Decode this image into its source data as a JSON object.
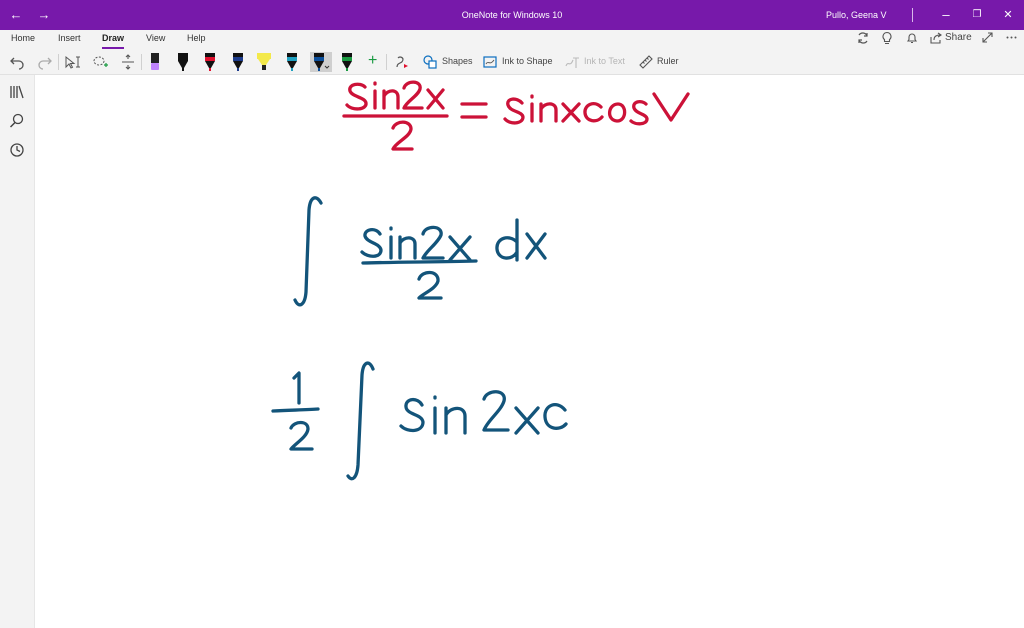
{
  "window": {
    "title": "OneNote for Windows 10",
    "user": "Pullo, Geena V",
    "back_label": "←",
    "forward_label": "→",
    "minimize_label": "–",
    "restore_label": "❐",
    "close_label": "✕"
  },
  "ribbon": {
    "tabs": [
      {
        "label": "Home"
      },
      {
        "label": "Insert"
      },
      {
        "label": "Draw"
      },
      {
        "label": "View"
      },
      {
        "label": "Help"
      }
    ],
    "active_tab": "Draw",
    "share_label": "Share"
  },
  "toolbar": {
    "shapes_label": "Shapes",
    "ink_to_shape_label": "Ink to Shape",
    "ink_to_text_label": "Ink to Text",
    "ruler_label": "Ruler",
    "add_pen_label": "+",
    "pens": [
      {
        "icon": "pencil-purple-icon",
        "color": "#c084fc"
      },
      {
        "icon": "pen-black-icon",
        "color": "#111111"
      },
      {
        "icon": "pen-red-icon",
        "color": "#e0102e"
      },
      {
        "icon": "pen-navy-icon",
        "color": "#1d3c8c"
      },
      {
        "icon": "highlighter-yellow-icon",
        "color": "#f3e94a"
      },
      {
        "icon": "pen-teal-icon",
        "color": "#1fa0c0"
      },
      {
        "icon": "pen-blue-icon",
        "color": "#0b4e9a"
      },
      {
        "icon": "pen-green-icon",
        "color": "#1a9a42"
      }
    ],
    "selected_pen": "pen-blue-icon"
  },
  "colors": {
    "accent": "#7719aa",
    "ink_red": "#cc1238",
    "ink_blue": "#13547a"
  },
  "sidebar": {
    "icons": [
      "notebooks-icon",
      "search-icon",
      "recent-icon"
    ]
  }
}
